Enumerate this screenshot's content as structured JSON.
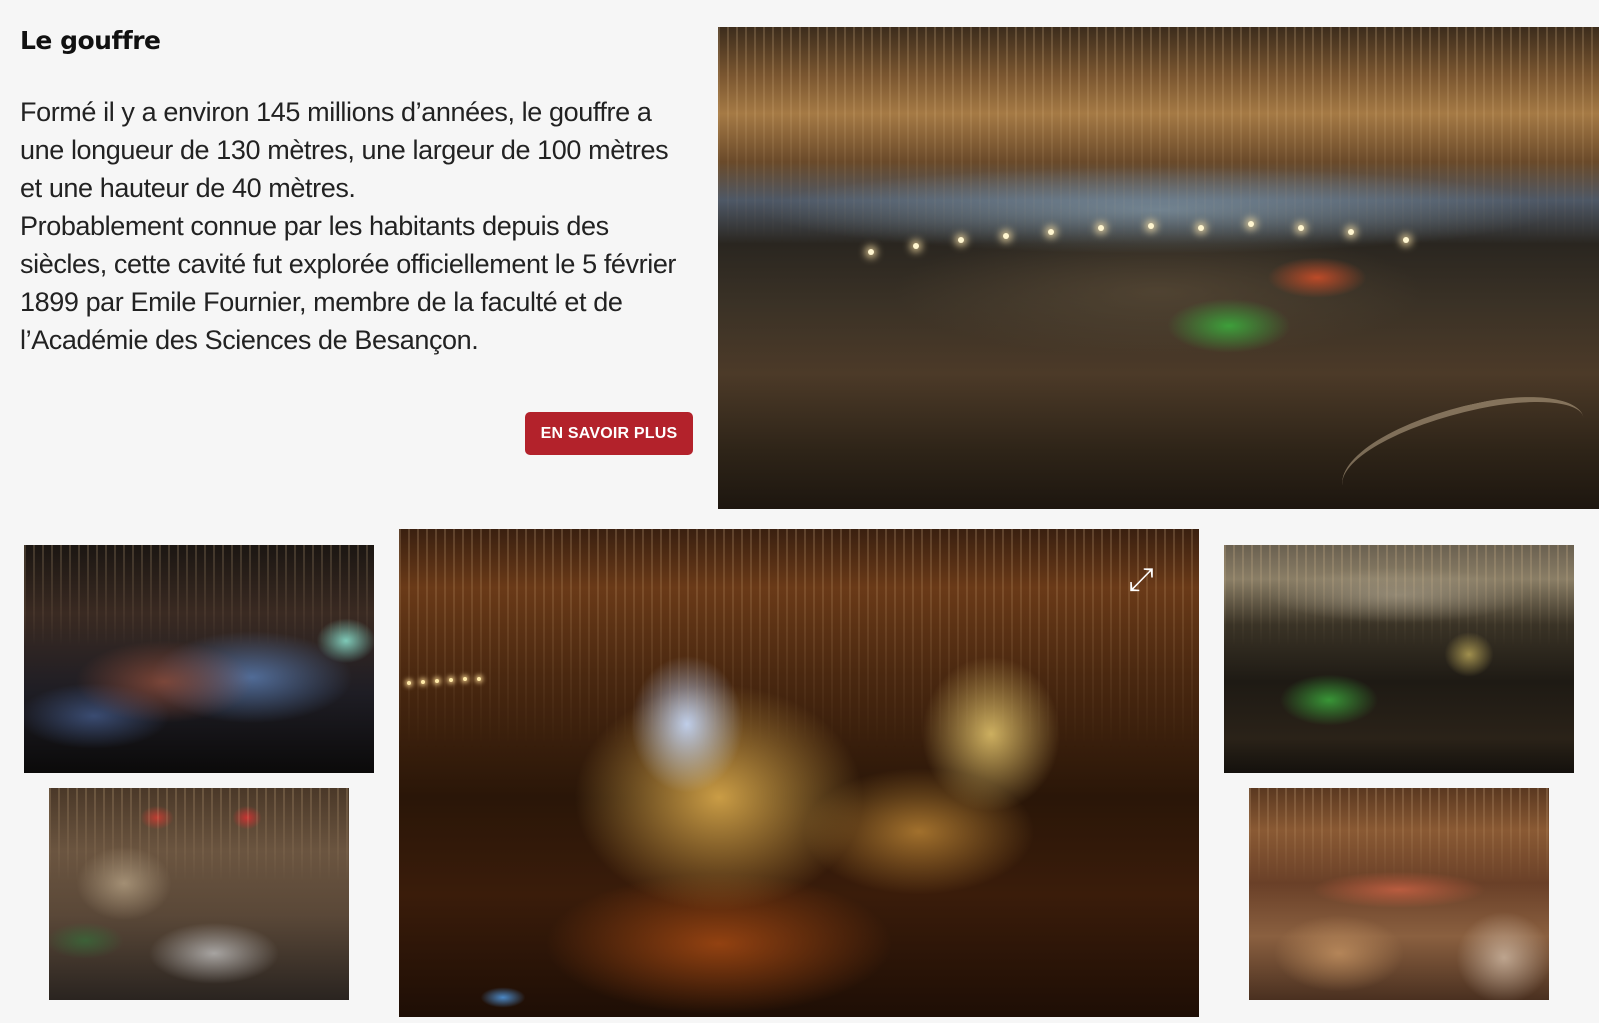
{
  "section": {
    "title": "Le gouffre",
    "paragraph_1": "Formé il y a environ 145 millions d’années, le gouffre a une longueur de 130 mètres, une largeur de 100 mètres et une hauteur de 40 mètres.",
    "paragraph_2": "Probablement connue par les habitants depuis des siècles, cette cavité fut explorée officiellement le 5 février 1899 par Emile Fournier, membre de la faculté et de l’Académie des Sciences de Besançon.",
    "cta_label": "EN SAVOIR PLUS"
  },
  "colors": {
    "accent": "#b3222b",
    "background": "#f6f6f6",
    "text": "#222222"
  },
  "gallery": {
    "expand_icon": "expand-icon"
  }
}
